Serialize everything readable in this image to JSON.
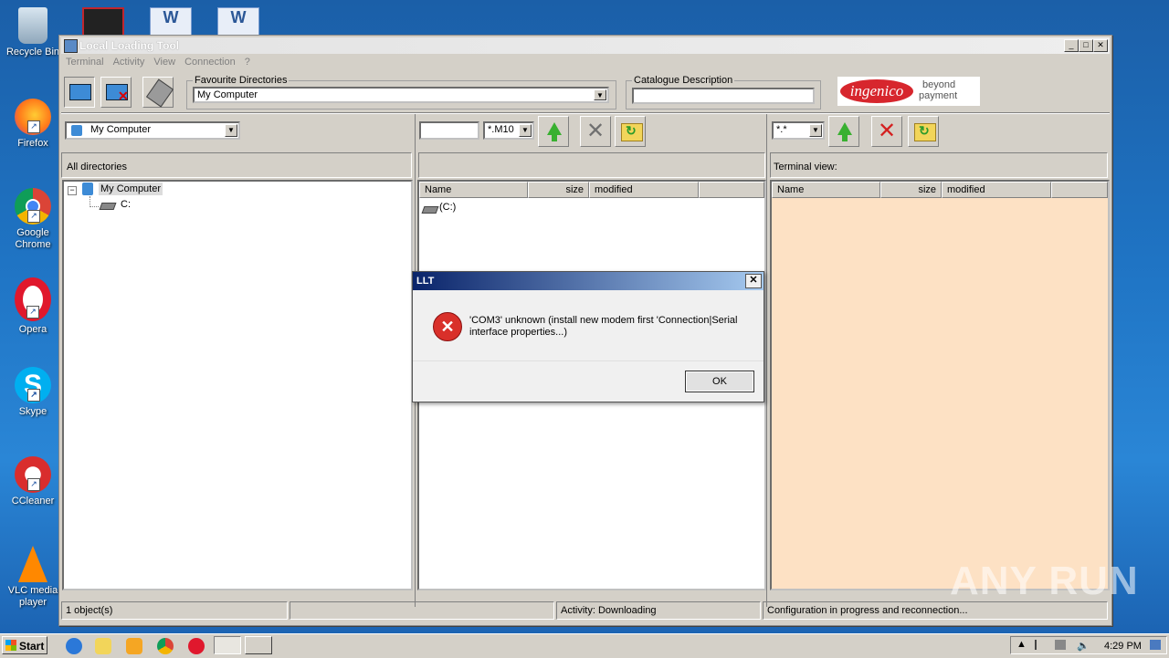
{
  "desktop": {
    "icons": [
      {
        "label": "Recycle Bin"
      },
      {
        "label": "Firefox"
      },
      {
        "label": "Google Chrome"
      },
      {
        "label": "Opera"
      },
      {
        "label": "Skype"
      },
      {
        "label": "CCleaner"
      },
      {
        "label": "VLC media player"
      }
    ]
  },
  "window": {
    "title": "Local Loading Tool",
    "menu": [
      "Terminal",
      "Activity",
      "View",
      "Connection",
      "?"
    ],
    "favourite_dirs": {
      "label": "Favourite Directories",
      "value": "My Computer"
    },
    "catalogue": {
      "label": "Catalogue Description",
      "value": ""
    },
    "brand": {
      "logo": "ingenico",
      "line1": "beyond",
      "line2": "payment"
    },
    "left_combo": "My Computer",
    "filter_input": "",
    "ext_combo": "*.M10",
    "terminal_filter": "*.*",
    "left_panel_label": "All directories",
    "tree": {
      "root": "My Computer",
      "child": "C:"
    },
    "middle": {
      "columns": [
        "Name",
        "size",
        "modified"
      ],
      "rows": [
        "(C:)"
      ]
    },
    "right": {
      "label": "Terminal view:",
      "columns": [
        "Name",
        "size",
        "modified"
      ]
    },
    "status": {
      "objects": "1 object(s)",
      "empty": "",
      "activity": "Activity: Downloading",
      "message": "Configuration in progress and reconnection..."
    }
  },
  "dialog": {
    "title": "LLT",
    "message": "'COM3' unknown (install new modem first 'Connection|Serial interface properties...)",
    "ok": "OK"
  },
  "taskbar": {
    "start": "Start",
    "clock": "4:29 PM"
  },
  "watermark": "ANY RUN",
  "colors": {
    "terminal_bg": "#fde1c4",
    "error_red": "#d9302a",
    "dialog_title": "#0a246a"
  }
}
